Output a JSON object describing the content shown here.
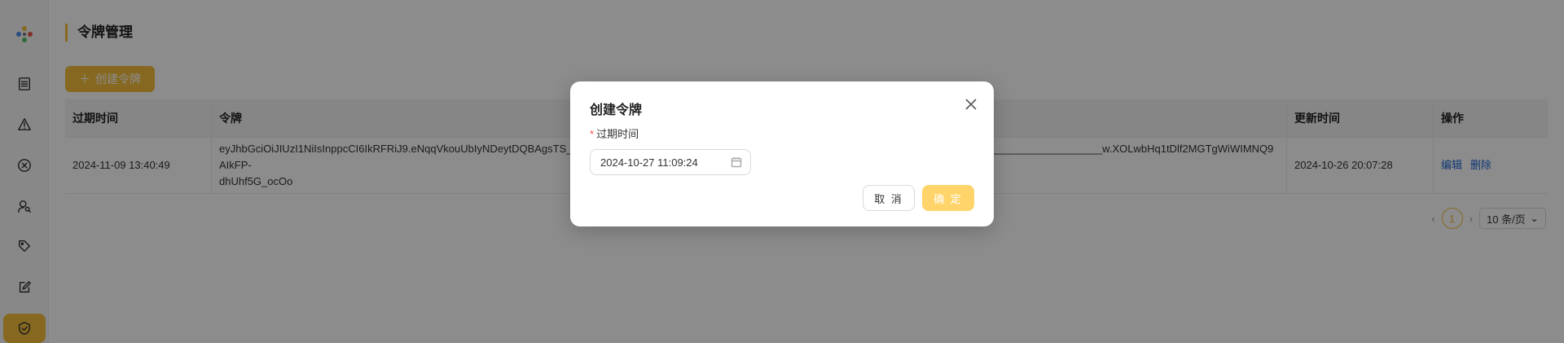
{
  "page": {
    "title": "令牌管理"
  },
  "toolbar": {
    "create_label": "创建令牌",
    "plus_icon": "plus-icon"
  },
  "sidebar": {
    "items": [
      {
        "icon": "list-icon"
      },
      {
        "icon": "warning-icon"
      },
      {
        "icon": "circle-x-icon"
      },
      {
        "icon": "user-search-icon"
      },
      {
        "icon": "tag-icon"
      },
      {
        "icon": "edit-icon"
      },
      {
        "icon": "shield-check-icon",
        "active": true
      }
    ]
  },
  "table": {
    "headers": [
      "过期时间",
      "令牌",
      "更新时间",
      "操作"
    ],
    "rows": [
      {
        "expire": "2024-11-09 13:40:49",
        "token_line1": "eyJhbGciOiJIUzI1NiIsInppcCI6IkRFRiJ9.eNqqVkouUbIyNDeytDQBAgsTS___________________________________________________________________________________________w.XOLwbHq1tDlf2MGTgWiWIMNQ9AIkFP-",
        "token_line2": "dhUhf5G_ocOo",
        "updated": "2024-10-26 20:07:28",
        "action_edit": "编辑",
        "action_delete": "删除"
      }
    ]
  },
  "pagination": {
    "current": "1",
    "page_size": "10 条/页"
  },
  "modal": {
    "title": "创建令牌",
    "field_label": "过期时间",
    "date_value": "2024-10-27 11:09:24",
    "cancel_label": "取 消",
    "ok_label": "确 定"
  },
  "colors": {
    "accent": "#f4be3b",
    "link": "#1d64d4",
    "required": "#ff4d4f"
  }
}
